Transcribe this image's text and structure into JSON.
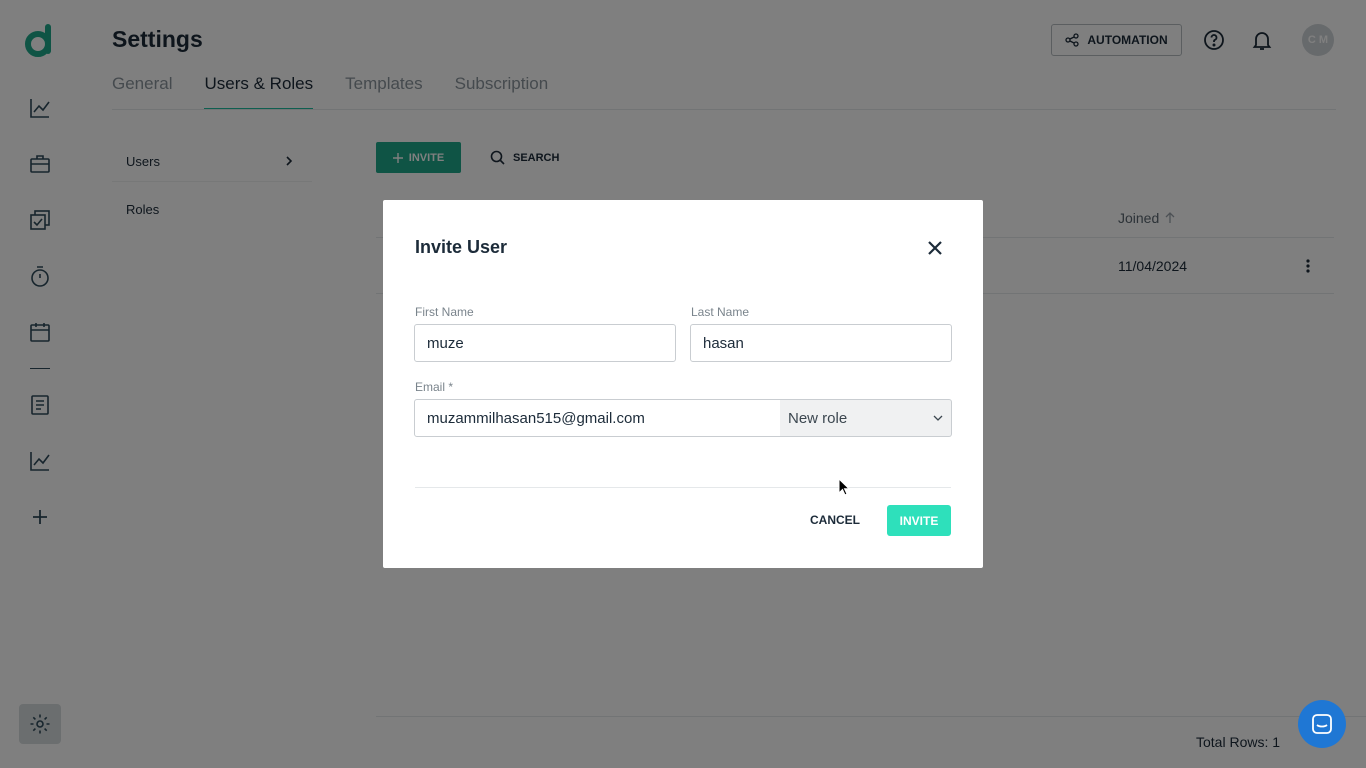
{
  "header": {
    "title": "Settings",
    "automation_label": "AUTOMATION",
    "avatar_initials": "C M"
  },
  "tabs": [
    {
      "label": "General",
      "active": false
    },
    {
      "label": "Users & Roles",
      "active": true
    },
    {
      "label": "Templates",
      "active": false
    },
    {
      "label": "Subscription",
      "active": false
    }
  ],
  "submenu": {
    "users_label": "Users",
    "roles_label": "Roles"
  },
  "toolbar": {
    "invite_label": "INVITE",
    "search_label": "SEARCH"
  },
  "table": {
    "joined_header": "Joined",
    "rows": [
      {
        "joined": "11/04/2024"
      }
    ],
    "total_rows_label": "Total Rows: 1"
  },
  "modal": {
    "title": "Invite User",
    "first_name_label": "First Name",
    "first_name_value": "muze",
    "last_name_label": "Last Name",
    "last_name_value": "hasan",
    "email_label": "Email *",
    "email_value": "muzammilhasan515@gmail.com",
    "role_value": "New role",
    "cancel_label": "CANCEL",
    "invite_label": "INVITE"
  },
  "colors": {
    "accent": "#1fa98a",
    "invite_modal_button": "#2ee0bb",
    "chat": "#1f77d4"
  }
}
